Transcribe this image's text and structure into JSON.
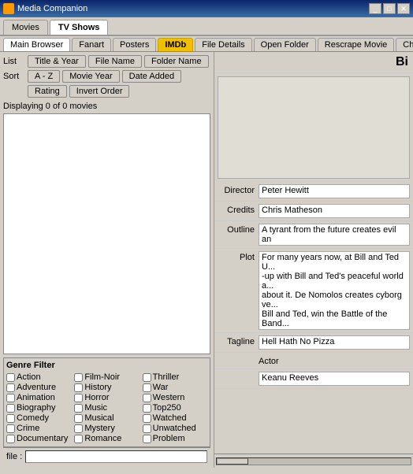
{
  "titleBar": {
    "title": "Media Companion",
    "buttons": [
      "_",
      "□",
      "✕"
    ]
  },
  "mainTabs": [
    {
      "label": "Movies",
      "active": false
    },
    {
      "label": "TV Shows",
      "active": true
    }
  ],
  "secTabs": [
    {
      "label": "Main Browser",
      "active": true,
      "style": "normal"
    },
    {
      "label": "Fanart",
      "active": false,
      "style": "normal"
    },
    {
      "label": "Posters",
      "active": false,
      "style": "normal"
    },
    {
      "label": "IMDb",
      "active": false,
      "style": "imdb"
    },
    {
      "label": "File Details",
      "active": false,
      "style": "normal"
    },
    {
      "label": "Open Folder",
      "active": false,
      "style": "normal"
    },
    {
      "label": "Rescrape Movie",
      "active": false,
      "style": "normal"
    },
    {
      "label": "Change N",
      "active": false,
      "style": "normal"
    }
  ],
  "leftPanel": {
    "listButtons": [
      "Title & Year",
      "File Name",
      "Folder Name"
    ],
    "sortButtons": [
      "A - Z",
      "Movie Year",
      "Date Added"
    ],
    "extraButtons": [
      "Rating",
      "Invert Order"
    ],
    "displayingText": "Displaying 0 of 0 movies",
    "genreFilter": {
      "title": "Genre Filter",
      "col1": [
        "Action",
        "Adventure",
        "Animation",
        "Biography",
        "Comedy",
        "Crime",
        "Documentary"
      ],
      "col2": [
        "Film-Noir",
        "History",
        "Horror",
        "Music",
        "Musical",
        "Mystery",
        "Romance"
      ],
      "col3": [
        "Thriller",
        "War",
        "Western",
        "Top250",
        "Watched",
        "Unwatched",
        "Problem"
      ]
    }
  },
  "rightPanel": {
    "movieTitle": "Bi",
    "director": {
      "label": "Director",
      "value": "Peter Hewitt"
    },
    "credits": {
      "label": "Credits",
      "value": "Chris Matheson"
    },
    "outline": {
      "label": "Outline",
      "value": "A tyrant from the future creates evil an"
    },
    "plot": {
      "label": "Plot",
      "value": "For many years now, at Bill and Ted U...\n-up with Bill and Ted's peaceful world a...\nabout it. De Nomolos creates cyborg ve...\nBill and Ted, win the Battle of the Band..."
    },
    "tagline": {
      "label": "Tagline",
      "value": "Hell Hath No Pizza"
    },
    "actor": {
      "label": "Actor",
      "value": "Keanu Reeves"
    }
  },
  "fileRow": {
    "label": "file :",
    "value": ""
  }
}
